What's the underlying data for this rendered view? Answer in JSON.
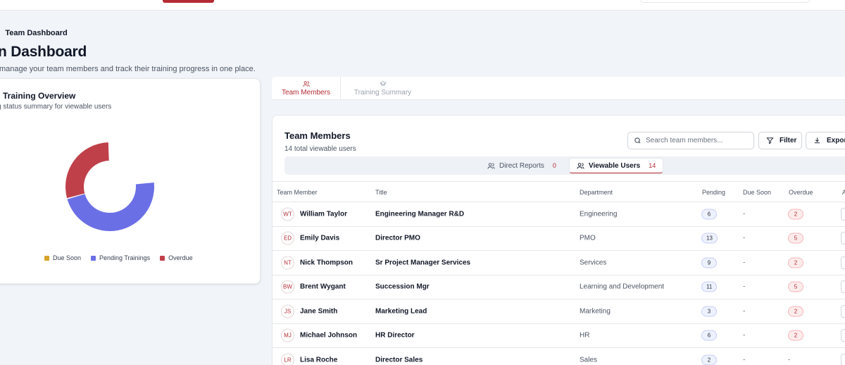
{
  "breadcrumb": {
    "current": "Team Dashboard"
  },
  "page": {
    "title": "n Dashboard",
    "subtitle": "manage your team members and track their training progress in one place."
  },
  "overview": {
    "title": "Training Overview",
    "subtitle": "g status summary for viewable users",
    "legend": [
      {
        "label": "Due Soon",
        "color": "#d4a32a"
      },
      {
        "label": "Pending Trainings",
        "color": "#6b6fe6"
      },
      {
        "label": "Overdue",
        "color": "#c0404a"
      }
    ],
    "donut": {
      "overdue": 45,
      "pending": 74,
      "due_soon": 0
    }
  },
  "tabs": [
    {
      "label": "Team Members",
      "icon": "users-icon",
      "active": true
    },
    {
      "label": "Training Summary",
      "icon": "graduation-cap-icon",
      "active": false
    }
  ],
  "members": {
    "title": "Team Members",
    "count_text": "14 total viewable users",
    "search_placeholder": "Search team members...",
    "filter_label": "Filter",
    "export_label": "Expor",
    "toggles": {
      "direct": {
        "label": "Direct Reports",
        "count": "0"
      },
      "viewable": {
        "label": "Viewable Users",
        "count": "14"
      }
    },
    "columns": {
      "member": "Team Member",
      "title": "Title",
      "department": "Department",
      "pending": "Pending",
      "due_soon": "Due Soon",
      "overdue": "Overdue",
      "action": "A"
    },
    "rows": [
      {
        "initials": "WT",
        "name": "William Taylor",
        "title": "Engineering Manager R&D",
        "department": "Engineering",
        "pending": "6",
        "due_soon": "-",
        "overdue": "2"
      },
      {
        "initials": "ED",
        "name": "Emily Davis",
        "title": "Director PMO",
        "department": "PMO",
        "pending": "13",
        "due_soon": "-",
        "overdue": "5"
      },
      {
        "initials": "NT",
        "name": "Nick Thompson",
        "title": "Sr Project Manager Services",
        "department": "Services",
        "pending": "9",
        "due_soon": "-",
        "overdue": "2"
      },
      {
        "initials": "BW",
        "name": "Brent Wygant",
        "title": "Succession Mgr",
        "department": "Learning and Development",
        "pending": "11",
        "due_soon": "-",
        "overdue": "5"
      },
      {
        "initials": "JS",
        "name": "Jane Smith",
        "title": "Marketing Lead",
        "department": "Marketing",
        "pending": "3",
        "due_soon": "-",
        "overdue": "2"
      },
      {
        "initials": "MJ",
        "name": "Michael Johnson",
        "title": "HR Director",
        "department": "HR",
        "pending": "6",
        "due_soon": "-",
        "overdue": "2"
      },
      {
        "initials": "LR",
        "name": "Lisa Roche",
        "title": "Director Sales",
        "department": "Sales",
        "pending": "2",
        "due_soon": "-",
        "overdue": "-"
      }
    ]
  }
}
